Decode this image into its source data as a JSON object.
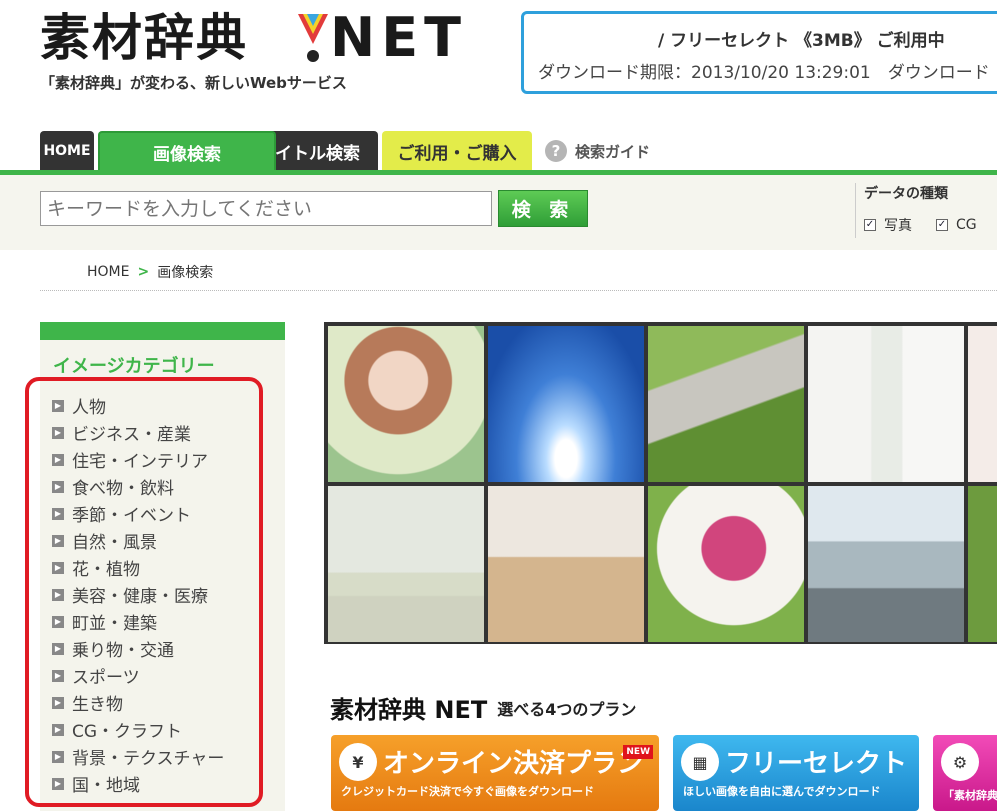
{
  "header": {
    "logo_text": "素材辞典",
    "logo_net": "NET",
    "tagline": "「素材辞典」が変わる、新しいWebサービス",
    "account": {
      "plan": "/ フリーセレクト 《3MB》 ご利用中",
      "expire": "ダウンロード期限：2013/10/20 13:29:01　ダウンロード"
    }
  },
  "nav": {
    "home": "HOME",
    "image_search": "画像検索",
    "title_search": "タイトル検索",
    "buy": "ご利用・ご購入",
    "guide": "検索ガイド",
    "guide_icon": "?"
  },
  "search": {
    "placeholder": "キーワードを入力してください",
    "button": "検 索"
  },
  "data_type": {
    "title": "データの種類",
    "options": [
      {
        "label": "写真",
        "checked": true
      },
      {
        "label": "CG",
        "checked": true
      }
    ]
  },
  "breadcrumb": {
    "home": "HOME",
    "sep": ">",
    "current": "画像検索"
  },
  "sidebar": {
    "title": "イメージカテゴリー",
    "categories": [
      "人物",
      "ビジネス・産業",
      "住宅・インテリア",
      "食べ物・飲料",
      "季節・イベント",
      "自然・風景",
      "花・植物",
      "美容・健康・医療",
      "町並・建築",
      "乗り物・交通",
      "スポーツ",
      "生き物",
      "CG・クラフト",
      "背景・テクスチャー",
      "国・地域"
    ]
  },
  "plans": {
    "logo": "素材辞典 NET",
    "title": "選べる4つのプラン",
    "online": {
      "name": "オンライン決済プラン",
      "sub": "クレジットカード決済で今すぐ画像をダウンロード",
      "badge": "NEW"
    },
    "free": {
      "name": "フリーセレクト",
      "sub": "ほしい画像を自由に選んでダウンロード"
    },
    "third": {
      "sub": "「素材辞典"
    }
  }
}
